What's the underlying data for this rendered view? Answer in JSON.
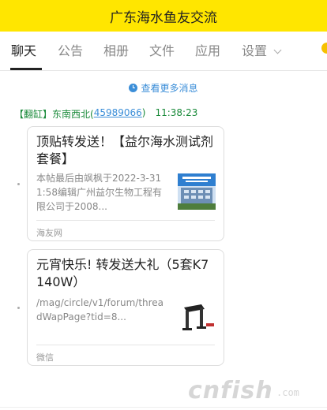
{
  "header": {
    "title": "广东海水鱼友交流"
  },
  "tabs": [
    {
      "label": "聊天"
    },
    {
      "label": "公告"
    },
    {
      "label": "相册"
    },
    {
      "label": "文件"
    },
    {
      "label": "应用"
    },
    {
      "label": "设置"
    }
  ],
  "chat": {
    "more_messages": "查看更多消息",
    "sender": {
      "tag": "【翻缸】",
      "name": "东南西北(",
      "qq": "45989066",
      "close": ")",
      "time": "11:38:23"
    },
    "messages": [
      {
        "title": "顶贴转发送！【益尔海水测试剂套餐】",
        "desc": "本帖最后由飒枫于2022-3-311:58编辑广州益尔生物工程有限公司于2008...",
        "source": "海友网",
        "thumb": "lab-building-photo"
      },
      {
        "title": "元宵快乐! 转发送大礼（5套K7 140W）",
        "desc": "/mag/circle/v1/forum/threadWapPage?tid=8...",
        "source": "微信",
        "thumb": "lamp-product-photo"
      }
    ]
  },
  "watermark": {
    "text": "cnfish",
    "suffix": ".com"
  },
  "colors": {
    "header_bg": "#ffe600",
    "link": "#3b8ed8",
    "sender": "#1a8a3a"
  }
}
